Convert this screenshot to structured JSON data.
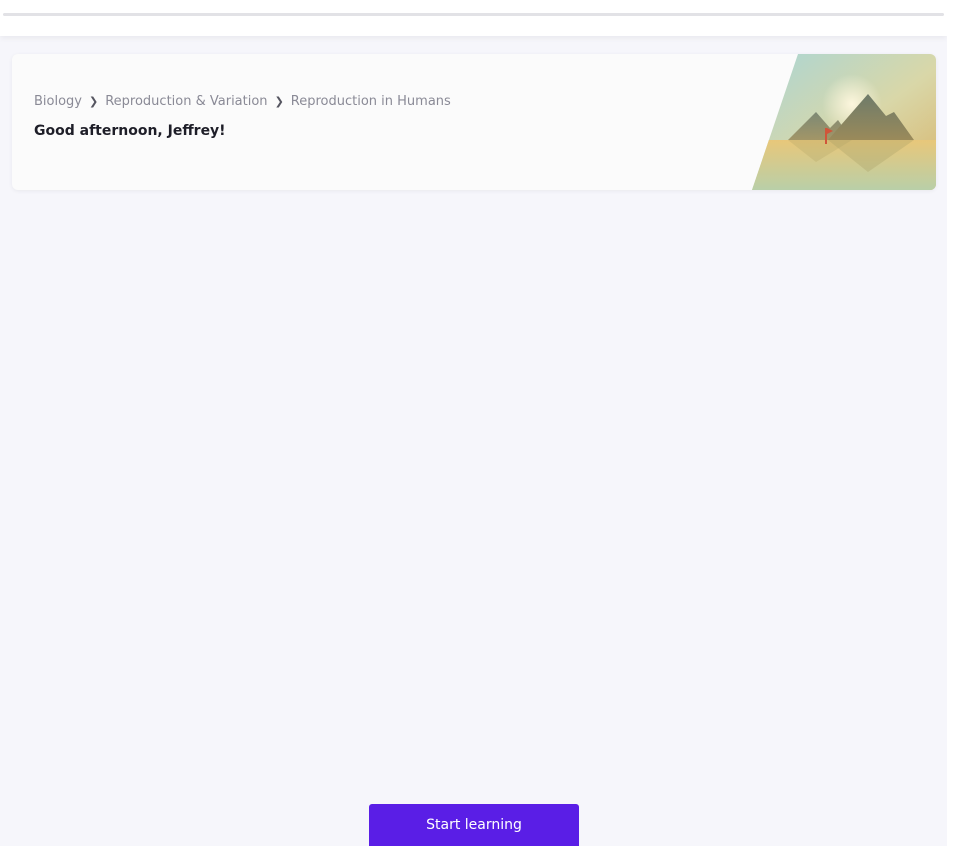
{
  "breadcrumb": {
    "items": [
      "Biology",
      "Reproduction & Variation",
      "Reproduction in Humans"
    ],
    "separator_icon": "chevron-right-icon"
  },
  "greeting": "Good afternoon, Jeffrey!",
  "hero": {
    "illustration_icon": "mountain-lake-illustration-icon"
  },
  "actions": {
    "start_label": "Start learning"
  },
  "colors": {
    "background": "#f6f6fb",
    "card": "#fbfbfb",
    "primary_button": "#5a1ee6",
    "breadcrumb_text": "#8a8a96",
    "greeting_text": "#1e1e28"
  }
}
